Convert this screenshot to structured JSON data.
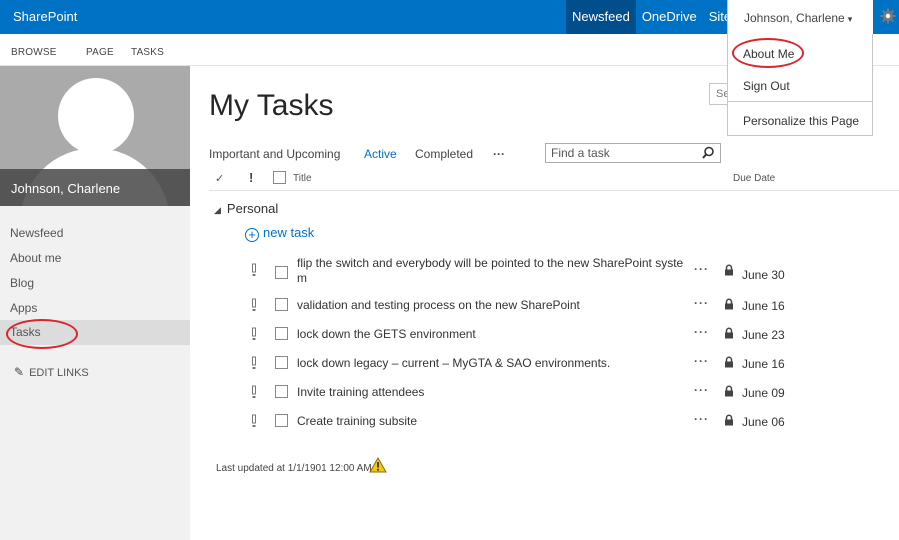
{
  "suitebar": {
    "brand": "SharePoint",
    "links": [
      "Newsfeed",
      "OneDrive",
      "Sites"
    ],
    "active_link": "Newsfeed",
    "user_name": "Johnson, Charlene",
    "user_caret": "▾"
  },
  "ribbon": {
    "tabs": [
      "BROWSE",
      "PAGE",
      "TASKS"
    ]
  },
  "profile": {
    "name": "Johnson, Charlene"
  },
  "leftnav": {
    "items": [
      "Newsfeed",
      "About me",
      "Blog",
      "Apps",
      "Tasks"
    ],
    "selected": "Tasks",
    "edit_links": "EDIT LINKS"
  },
  "main": {
    "title": "My Tasks",
    "search_sliver": "Se",
    "view_tabs": [
      "Important and Upcoming",
      "Active",
      "Completed",
      "···"
    ],
    "active_view": "Active",
    "find_placeholder": "Find a task",
    "columns": {
      "check": "✓",
      "important": "!",
      "title": "Title",
      "due": "Due Date"
    },
    "group": "Personal",
    "group_toggle": "◢",
    "new_task": "new task",
    "tasks": [
      {
        "title": "flip the switch and everybody will be pointed to the new SharePoint syste m",
        "due": "June 30"
      },
      {
        "title": "validation and testing process on the new SharePoint",
        "due": "June 16"
      },
      {
        "title": "lock down the GETS environment",
        "due": "June 23"
      },
      {
        "title": "lock down legacy – current – MyGTA & SAO environments.",
        "due": "June 16"
      },
      {
        "title": "Invite training attendees",
        "due": "June 09"
      },
      {
        "title": "Create training subsite",
        "due": "June 06"
      }
    ],
    "row_ellipsis": "···",
    "last_updated": "Last updated at 1/1/1901 12:00 AM"
  },
  "dropdown": {
    "items": [
      "About Me",
      "Sign Out",
      "Personalize this Page"
    ]
  },
  "colors": {
    "suitebar": "#0072c6",
    "suitebar_active": "#004e8c",
    "link": "#0072c6",
    "highlight": "#d9262c",
    "warning": "#f2c811"
  },
  "icons": {
    "gear": "gear-icon",
    "pencil": "pencil-icon",
    "plus": "plus-circle-icon",
    "search": "search-icon",
    "lock": "lock-icon",
    "warning": "warning-icon"
  }
}
